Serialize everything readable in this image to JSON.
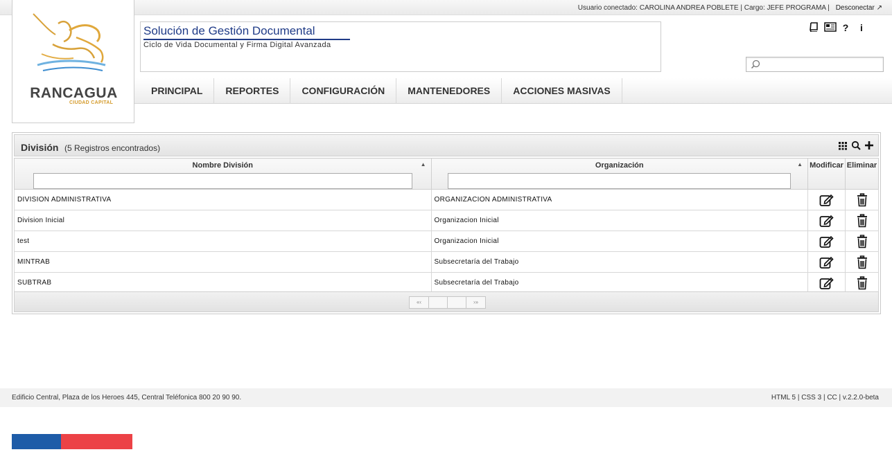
{
  "topbar": {
    "user_info": "Usuario conectado: CAROLINA ANDREA POBLETE | Cargo: JEFE PROGRAMA |",
    "logout_label": "Desconectar"
  },
  "logo": {
    "name": "RANCAGUA",
    "subtitle": "CIUDAD CAPITAL"
  },
  "header": {
    "title": "Solución de Gestión Documental",
    "subtitle": "Ciclo de Vida Documental y Firma Digital Avanzada",
    "icons": [
      "book-icon",
      "news-icon",
      "help-icon",
      "info-icon"
    ],
    "help_glyph": "?",
    "info_glyph": "i"
  },
  "search": {
    "placeholder": ""
  },
  "nav": {
    "items": [
      {
        "label": "PRINCIPAL"
      },
      {
        "label": "REPORTES"
      },
      {
        "label": "CONFIGURACIÓN"
      },
      {
        "label": "MANTENEDORES"
      },
      {
        "label": "ACCIONES MASIVAS"
      }
    ]
  },
  "panel": {
    "title": "División",
    "count": "(5 Registros encontrados)",
    "tools": [
      "columns-icon",
      "search-icon",
      "add-icon"
    ],
    "columns": {
      "name": "Nombre División",
      "org": "Organización",
      "modify": "Modificar",
      "delete": "Eliminar"
    },
    "rows": [
      {
        "name": "DIVISION ADMINISTRATIVA",
        "org": "ORGANIZACION ADMINISTRATIVA"
      },
      {
        "name": "Division Inicial",
        "org": "Organizacion Inicial"
      },
      {
        "name": "test",
        "org": "Organizacion Inicial"
      },
      {
        "name": "MINTRAB",
        "org": "Subsecretaría del Trabajo"
      },
      {
        "name": "SUBTRAB",
        "org": "Subsecretaría del Trabajo"
      }
    ],
    "pager": {
      "first": "«‹",
      "last": "›»"
    }
  },
  "footer": {
    "address": "Edificio Central, Plaza de los Heroes 445, Central Teléfonica 800 20 90 90.",
    "meta": "HTML 5 | CSS 3 | CC | v.2.2.0-beta"
  },
  "colors": {
    "title_blue": "#1f3b87",
    "flag_blue": "#1e5ca8",
    "flag_red": "#ec4246"
  }
}
